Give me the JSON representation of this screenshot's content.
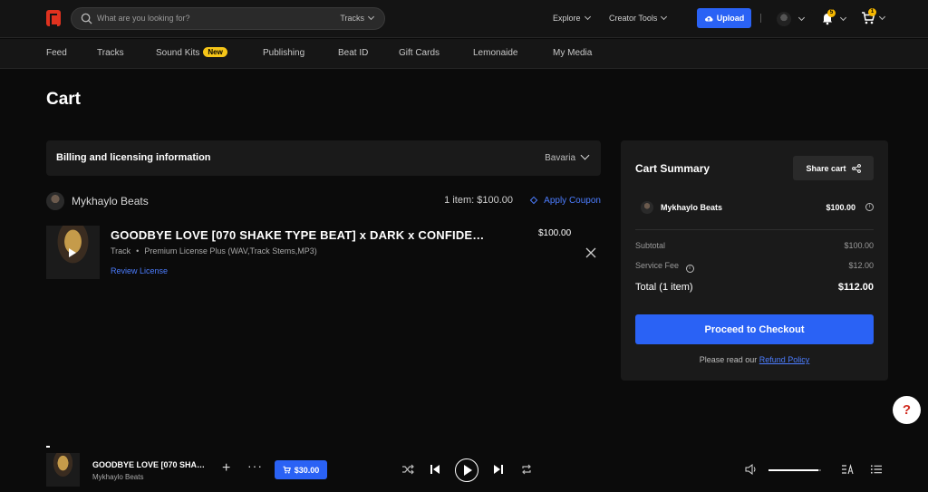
{
  "search": {
    "placeholder": "What are you looking for?",
    "scope": "Tracks"
  },
  "topnav": {
    "explore": "Explore",
    "creator_tools": "Creator Tools",
    "upload": "Upload",
    "notifications_count": "5",
    "cart_count": "1"
  },
  "subnav": {
    "items": [
      "Feed",
      "Tracks",
      "Sound Kits",
      "Publishing",
      "Beat ID",
      "Gift Cards",
      "Lemonaide",
      "My Media"
    ],
    "new_badge": "New"
  },
  "page": {
    "title": "Cart"
  },
  "billing": {
    "label": "Billing and licensing information",
    "region": "Bavaria"
  },
  "seller": {
    "name": "Mykhaylo Beats",
    "count": "1 item: $100.00",
    "coupon": "Apply Coupon"
  },
  "item": {
    "title": "GOODBYE LOVE [070 SHAKE TYPE BEAT] x DARK x CONFIDE…",
    "type": "Track",
    "license": "Premium License Plus (WAV,Track Stems,MP3)",
    "review": "Review License",
    "price": "$100.00"
  },
  "summary": {
    "title": "Cart Summary",
    "share": "Share cart",
    "seller_name": "Mykhaylo Beats",
    "seller_price": "$100.00",
    "subtotal_label": "Subtotal",
    "subtotal": "$100.00",
    "fee_label": "Service Fee",
    "fee": "$12.00",
    "total_label": "Total (1 item)",
    "total": "$112.00",
    "checkout": "Proceed to Checkout",
    "refund_prefix": "Please read our",
    "refund_link": "Refund Policy"
  },
  "help": "?",
  "player": {
    "title": "GOODBYE LOVE [070 SHA…",
    "artist": "Mykhaylo Beats",
    "price": "$30.00",
    "volume": 0.95
  },
  "colors": {
    "accent": "#2a62f5",
    "brand": "#e0321f",
    "badge": "#f5c518"
  }
}
